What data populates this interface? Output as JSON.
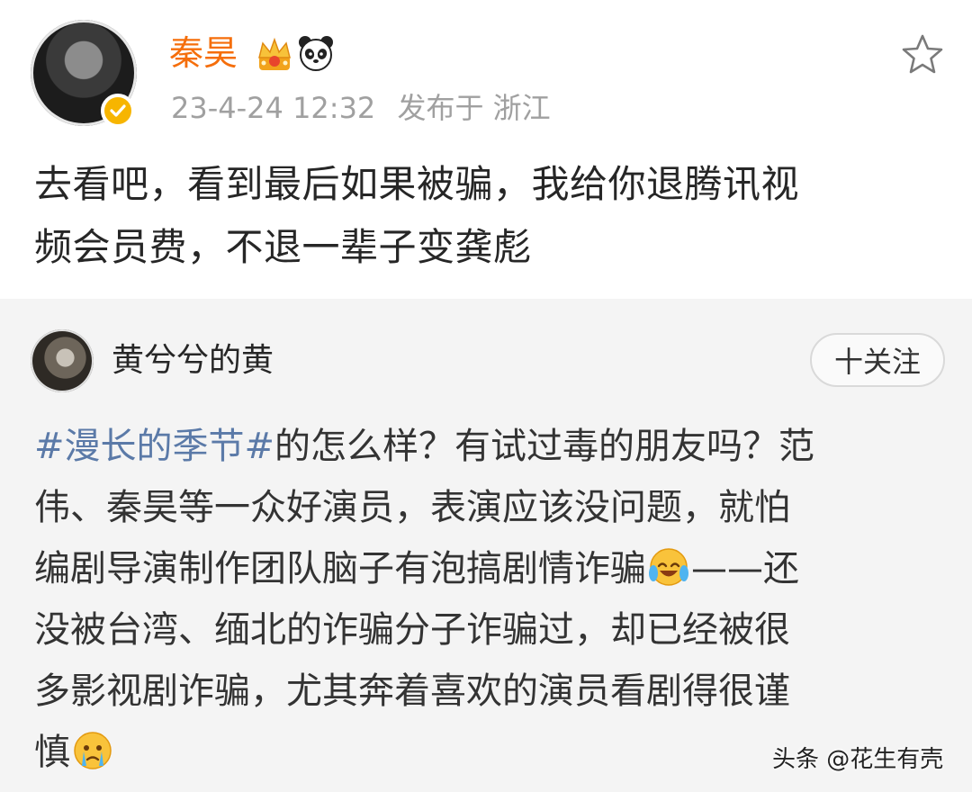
{
  "post": {
    "author": "秦昊",
    "timestamp": "23-4-24 12:32",
    "location": "发布于 浙江",
    "text_line1": "去看吧，看到最后如果被骗，我给你退腾讯视",
    "text_line2": "频会员费，不退一辈子变龚彪",
    "badges": [
      "crown-icon",
      "panda-icon"
    ]
  },
  "repost": {
    "author": "黄兮兮的黄",
    "follow_label": "十关注",
    "hashtag": "#漫长的季节#",
    "line1_rest": "的怎么样？有试过毒的朋友吗？范",
    "line2": "伟、秦昊等一众好演员，表演应该没问题，就怕",
    "line3_a": "编剧导演制作团队脑子有泡搞剧情诈骗",
    "line3_b": "——还",
    "line4": "没被台湾、缅北的诈骗分子诈骗过，却已经被很",
    "line5": "多影视剧诈骗，尤其奔着喜欢的演员看剧得很谨",
    "line6": "慎"
  },
  "watermark": "头条 @花生有壳",
  "colors": {
    "author_orange": "#f56e0b",
    "hashtag_blue": "#5b7aa8",
    "meta_gray": "#a0a0a0",
    "repost_bg": "#f4f4f4",
    "verified_gold": "#f7b500"
  }
}
